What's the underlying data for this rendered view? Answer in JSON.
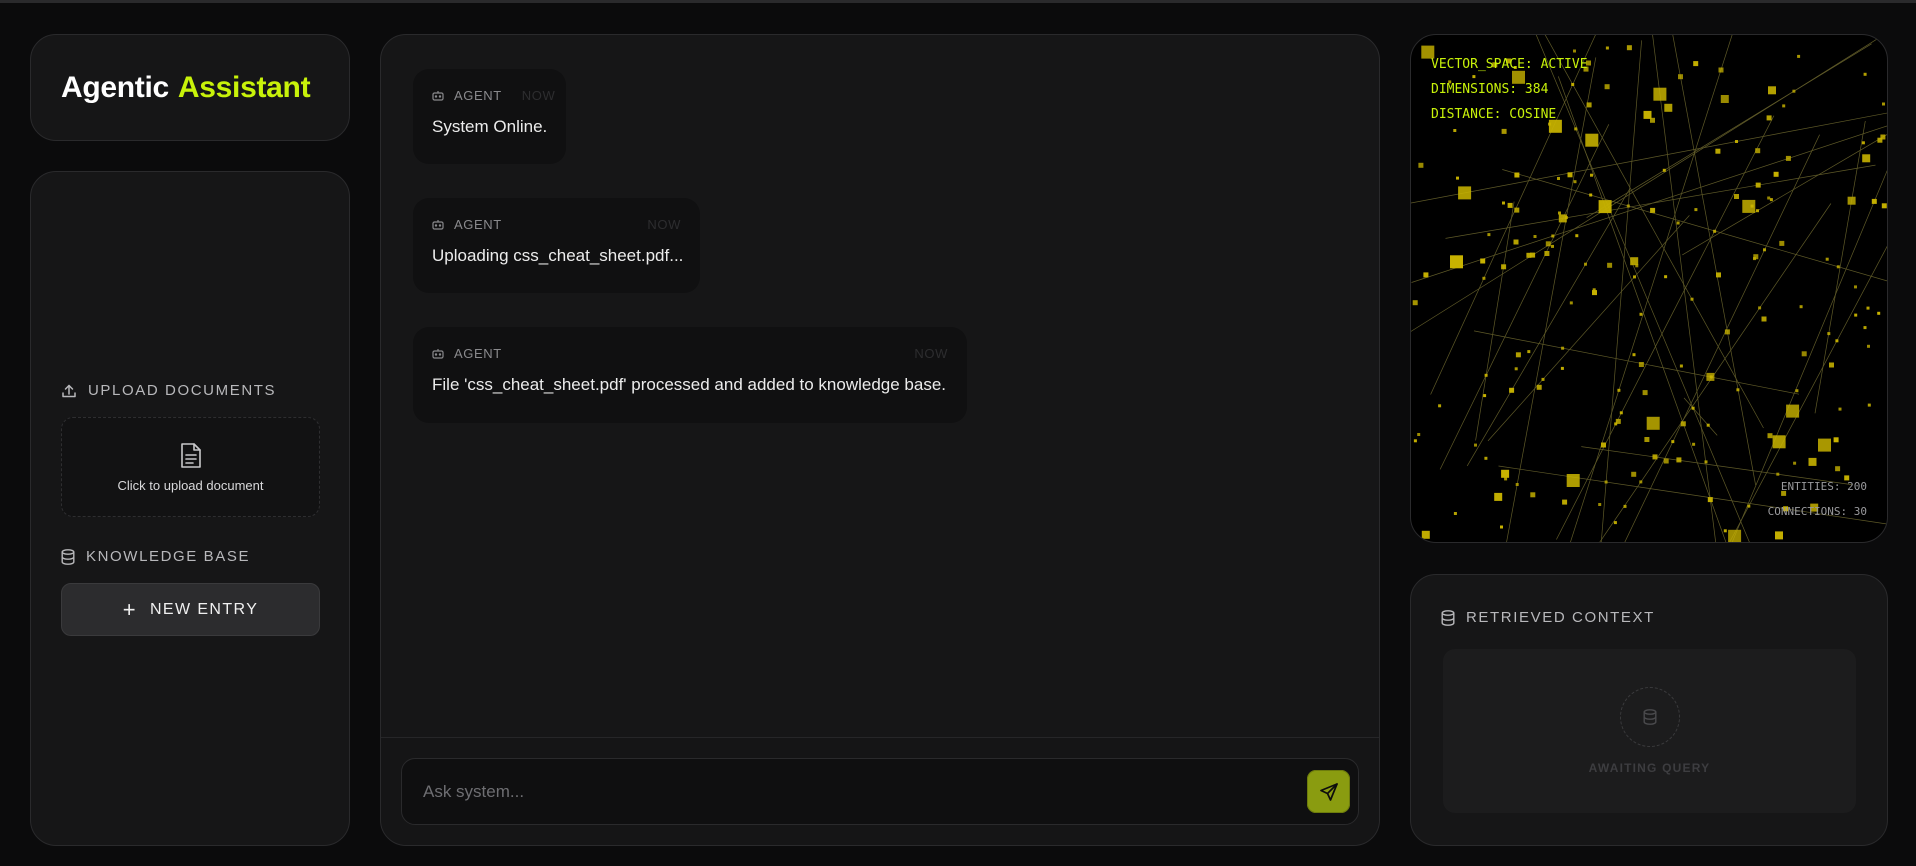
{
  "logo": {
    "part1": "Agentic",
    "part2": "Assistant"
  },
  "sidebar": {
    "upload_title": "Upload Documents",
    "upload_label": "Click to upload document",
    "kb_title": "Knowledge Base",
    "new_entry_label": "New Entry",
    "new_entry_icon": "+"
  },
  "chat": {
    "messages": [
      {
        "sender": "Agent",
        "time": "Now",
        "text": "System Online."
      },
      {
        "sender": "Agent",
        "time": "Now",
        "text": "Uploading css_cheat_sheet.pdf..."
      },
      {
        "sender": "Agent",
        "time": "Now",
        "text": "File 'css_cheat_sheet.pdf' processed and added to knowledge base."
      }
    ],
    "input_placeholder": "Ask system..."
  },
  "vector_space": {
    "status": "VECTOR_SPACE: ACTIVE",
    "dimensions": "DIMENSIONS: 384",
    "distance": "DISTANCE: COSINE",
    "entities": "ENTITIES: 200",
    "connections": "CONNECTIONS: 30"
  },
  "context": {
    "title": "Retrieved Context",
    "empty_text": "Awaiting Query"
  },
  "colors": {
    "accent": "#c8f20a",
    "node": "#c9b400",
    "send_button": "#8a9c10"
  }
}
